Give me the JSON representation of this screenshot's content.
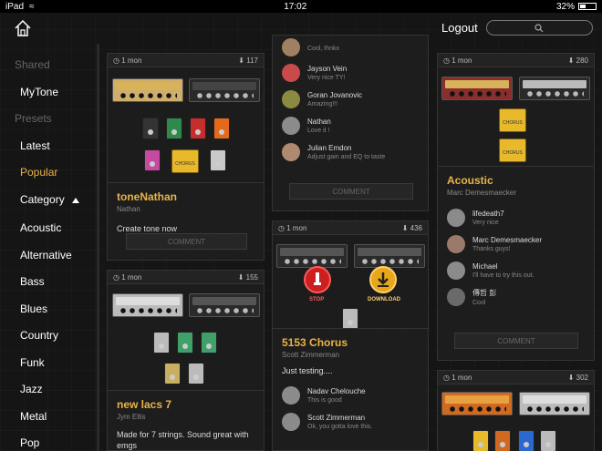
{
  "status": {
    "device": "iPad",
    "time": "17:02",
    "battery": "32%"
  },
  "header": {
    "logout": "Logout",
    "search_placeholder": ""
  },
  "sidebar": {
    "shared_title": "Shared",
    "mytone": "MyTone",
    "presets_title": "Presets",
    "items": [
      "Latest",
      "Popular",
      "Category",
      "Acoustic",
      "Alternative",
      "Bass",
      "Blues",
      "Country",
      "Funk",
      "Jazz",
      "Metal",
      "Pop"
    ]
  },
  "colors": {
    "accent": "#e8b448",
    "stop": "#cc1f1f",
    "download": "#e8a61a"
  },
  "cards": {
    "c1": {
      "age": "1 mon",
      "downloads": "117",
      "title": "toneNathan",
      "author": "Nathan",
      "desc": "Create tone now",
      "comment": "COMMENT",
      "amps": [
        "'69 Plexiglas",
        "''09 ... "
      ],
      "pedals": [
        "flanger",
        "CHORUS"
      ]
    },
    "c2": {
      "age": "1 mon",
      "downloads": "155",
      "title": "new lacs 7",
      "author": "Jym Ellis",
      "desc": "Made for 7 strings. Sound great with emgs",
      "amps": [
        "'57 Deluxe Jet",
        "'04 Insane 5153"
      ]
    },
    "c3": {
      "comments": [
        {
          "name": "",
          "text": "Cool, thnkx"
        },
        {
          "name": "Jayson Vein",
          "text": "Very nice TY!"
        },
        {
          "name": "Goran Jovanovic",
          "text": "Amazing!!!"
        },
        {
          "name": "Nathan",
          "text": "Love it !"
        },
        {
          "name": "Julian Emdon",
          "text": "Adjust gain and EQ to taste"
        }
      ],
      "comment": "COMMENT"
    },
    "c4": {
      "age": "1 mon",
      "downloads": "436",
      "title": "5153 Chorus",
      "author": "Scott Zimmerman",
      "desc": "Just testing....",
      "amps": [
        "'04 Insane 5153",
        "'04 Insane 5153"
      ],
      "stop": "STOP",
      "download": "DOWNLOAD",
      "comments": [
        {
          "name": "Nadav Chelouche",
          "text": "This is good"
        },
        {
          "name": "Scott Zimmerman",
          "text": "Ok, you gotta love this."
        }
      ]
    },
    "c5": {
      "age": "1 mon",
      "downloads": "280",
      "title": "Acoustic",
      "author": "Marc Demesmaecker",
      "comment": "COMMENT",
      "amps": [
        "'69 Plexiglas",
        "'65 Twin Verb"
      ],
      "pedals": [
        "CHORUS",
        "CHORUS"
      ],
      "comments": [
        {
          "name": "lifedeath7",
          "text": "Very nice"
        },
        {
          "name": "Marc Demesmaecker",
          "text": "Thanks guys!"
        },
        {
          "name": "Michael",
          "text": "I'll have to try this out."
        },
        {
          "name": "傳哲 彭",
          "text": "Cool"
        }
      ]
    },
    "c6": {
      "age": "1 mon",
      "downloads": "302"
    }
  }
}
